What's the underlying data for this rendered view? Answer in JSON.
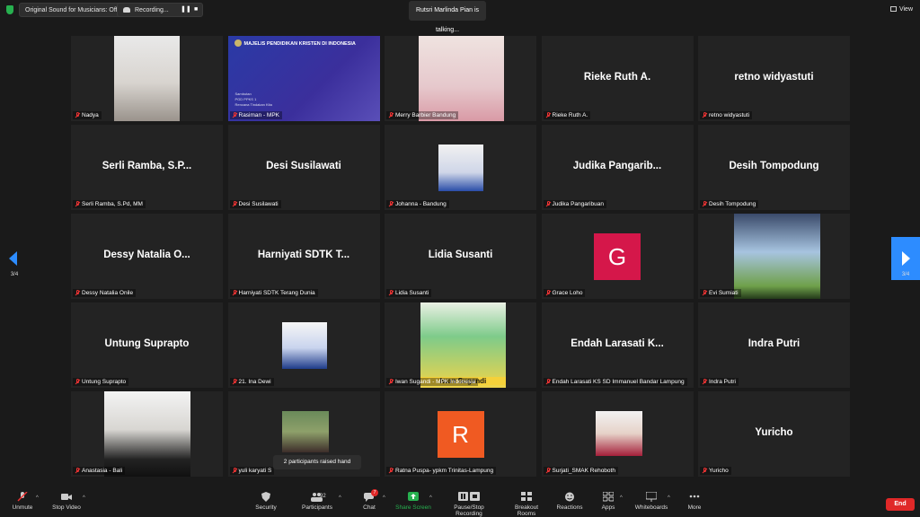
{
  "top": {
    "original_sound": "Original Sound for Musicians: Off",
    "recording": "Recording...",
    "talking": "Rutsri Marlinda Pian is talking...",
    "view": "View"
  },
  "tiles": [
    {
      "label": "Nadya",
      "big": ""
    },
    {
      "label": "Rasiman - MPK",
      "big": "",
      "slide_title": "MAJELIS PENDIDIKAN KRISTEN DI INDONESIA",
      "slide_lines": [
        "Sambutan",
        "PGD PPKS 1",
        "Rencana Tindakan Kita"
      ]
    },
    {
      "label": "Merry Barbier Bandung",
      "big": ""
    },
    {
      "label": "Rieke Ruth A.",
      "big": "Rieke Ruth A."
    },
    {
      "label": "retno widyastuti",
      "big": "retno widyastuti"
    },
    {
      "label": "Serli Ramba, S.Pd, MM",
      "big": "Serli Ramba, S.P..."
    },
    {
      "label": "Desi Susilawati",
      "big": "Desi Susilawati"
    },
    {
      "label": "Johanna - Bandung",
      "big": ""
    },
    {
      "label": "Judika Pangaribuan",
      "big": "Judika Pangarib..."
    },
    {
      "label": "Desih Tompodung",
      "big": "Desih Tompodung"
    },
    {
      "label": "Dessy Natalia Onile",
      "big": "Dessy Natalia O..."
    },
    {
      "label": "Harniyati SDTK Terang Dunia",
      "big": "Harniyati SDTK T..."
    },
    {
      "label": "Lidia Susanti",
      "big": "Lidia Susanti"
    },
    {
      "label": "Grace Loho",
      "big": "",
      "letter": "G"
    },
    {
      "label": "Evi Sumiati",
      "big": ""
    },
    {
      "label": "Untung Suprapto",
      "big": "Untung Suprapto"
    },
    {
      "label": "21. Ina Dewi",
      "big": ""
    },
    {
      "label": "Iwan Sugandi - MPK Indonesia",
      "big": "",
      "photo_caption": "Iwan Sugandi"
    },
    {
      "label": "Endah Larasati KS SD Immanuel Bandar Lampung",
      "big": "Endah Larasati K..."
    },
    {
      "label": "Indra Putri",
      "big": "Indra Putri"
    },
    {
      "label": "Anastasia - Bali",
      "big": ""
    },
    {
      "label": "yuli karyati S",
      "big": ""
    },
    {
      "label": "Ratna Puspa- ypkm Trinitas-Lampung",
      "big": "",
      "letter": "R"
    },
    {
      "label": "Surjati_SMAK Rehoboth",
      "big": ""
    },
    {
      "label": "Yuricho",
      "big": "Yuricho"
    }
  ],
  "page_left": "3/4",
  "page_right": "3/4",
  "toast": "2 participants raised hand",
  "toolbar": {
    "unmute": "Unmute",
    "stop_video": "Stop Video",
    "security": "Security",
    "participants": "Participants",
    "participants_count": "92",
    "chat": "Chat",
    "chat_badge": "7",
    "share": "Share Screen",
    "record": "Pause/Stop Recording",
    "breakout": "Breakout Rooms",
    "reactions": "Reactions",
    "apps": "Apps",
    "whiteboards": "Whiteboards",
    "more": "More",
    "end": "End"
  },
  "colors": {
    "accent": "#2d8cff",
    "green": "#27b04f",
    "end": "#e02828",
    "grace": "#d5174a",
    "ratna": "#f05a22"
  }
}
